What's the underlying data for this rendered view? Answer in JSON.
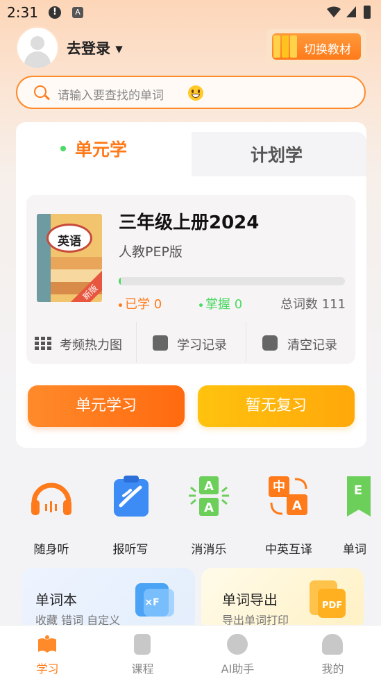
{
  "status_bar": {
    "time": "2:31"
  },
  "header": {
    "login_label": "去登录 ▾",
    "switch_label": "切换教材"
  },
  "search": {
    "placeholder": "请输入要查找的单词"
  },
  "tabs": [
    {
      "label": "单元学"
    },
    {
      "label": "计划学"
    }
  ],
  "book": {
    "cover_badge": "英语",
    "cover_corner": "新版",
    "title": "三年级上册2024",
    "edition": "人教PEP版",
    "progress": 0.01,
    "learned": "已学 0",
    "mastered": "掌握 0",
    "total": "总词数 111"
  },
  "actions": [
    {
      "label": "考频热力图"
    },
    {
      "label": "学习记录"
    },
    {
      "label": "清空记录"
    }
  ],
  "buttons": {
    "unit_study": "单元学习",
    "review": "暂无复习"
  },
  "features": [
    {
      "label": "随身听",
      "icon": "headphones-icon"
    },
    {
      "label": "报听写",
      "icon": "dictation-icon"
    },
    {
      "label": "消消乐",
      "icon": "match-game-icon"
    },
    {
      "label": "中英互译",
      "icon": "translate-icon"
    },
    {
      "label": "单词",
      "icon": "word-icon"
    }
  ],
  "bottom_cards": [
    {
      "title": "单词本",
      "subtitle": "收藏 错词 自定义"
    },
    {
      "title": "单词导出",
      "subtitle": "导出单词打印",
      "icon_text": "PDF"
    }
  ],
  "nav": [
    {
      "label": "学习",
      "active": true
    },
    {
      "label": "课程"
    },
    {
      "label": "AI助手"
    },
    {
      "label": "我的"
    }
  ],
  "colors": {
    "accent": "#ff7a1a",
    "green": "#4cd964",
    "yellow": "#ffb30e"
  }
}
